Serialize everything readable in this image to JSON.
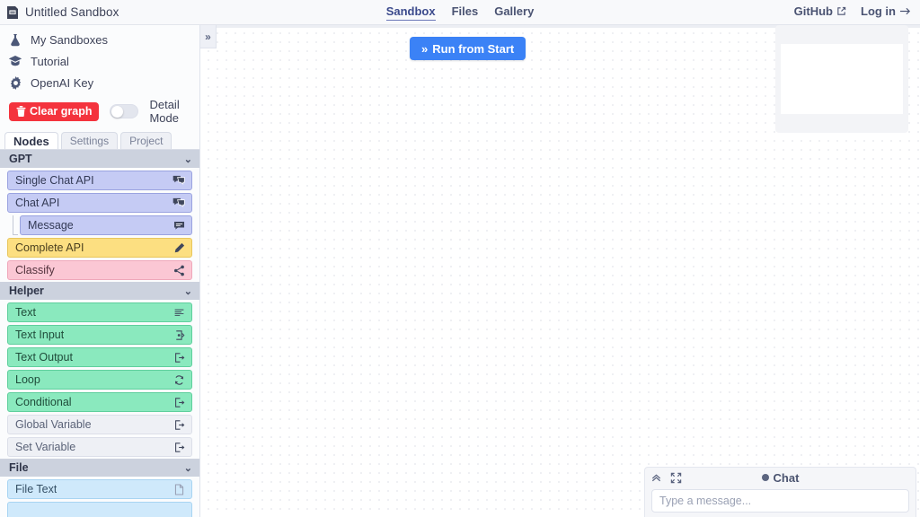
{
  "topbar": {
    "doc_icon": "file-save-icon",
    "title": "Untitled Sandbox",
    "nav": [
      {
        "label": "Sandbox",
        "active": true
      },
      {
        "label": "Files",
        "active": false
      },
      {
        "label": "Gallery",
        "active": false
      }
    ],
    "github_label": "GitHub",
    "github_icon": "external-link-icon",
    "login_label": "Log in",
    "login_icon": "arrow-right-icon"
  },
  "sidebar": {
    "menu": [
      {
        "label": "My Sandboxes",
        "icon": "flask-icon"
      },
      {
        "label": "Tutorial",
        "icon": "graduation-cap-icon"
      },
      {
        "label": "OpenAI Key",
        "icon": "gear-icon"
      }
    ],
    "clear_graph_label": "Clear graph",
    "clear_graph_icon": "trash-icon",
    "detail_mode_label": "Detail Mode",
    "detail_mode_on": false,
    "tabs": [
      {
        "label": "Nodes",
        "active": true
      },
      {
        "label": "Settings",
        "active": false
      },
      {
        "label": "Project",
        "active": false
      }
    ],
    "groups": [
      {
        "title": "GPT",
        "caret": "chevron-down-icon",
        "nodes": [
          {
            "label": "Single Chat API",
            "style": "n-gpt",
            "icon": "chat-bubbles-icon",
            "indent": false
          },
          {
            "label": "Chat API",
            "style": "n-gpt",
            "icon": "chat-bubbles-icon",
            "indent": false
          },
          {
            "label": "Message",
            "style": "n-gpt",
            "icon": "message-icon",
            "indent": true
          },
          {
            "label": "Complete API",
            "style": "n-yellow",
            "icon": "pencil-icon",
            "indent": false
          },
          {
            "label": "Classify",
            "style": "n-pink",
            "icon": "share-nodes-icon",
            "indent": false
          }
        ]
      },
      {
        "title": "Helper",
        "caret": "chevron-down-icon",
        "nodes": [
          {
            "label": "Text",
            "style": "n-green",
            "icon": "text-lines-icon",
            "indent": false
          },
          {
            "label": "Text Input",
            "style": "n-green",
            "icon": "input-icon",
            "indent": false
          },
          {
            "label": "Text Output",
            "style": "n-green",
            "icon": "output-icon",
            "indent": false
          },
          {
            "label": "Loop",
            "style": "n-green",
            "icon": "loop-icon",
            "indent": false
          },
          {
            "label": "Conditional",
            "style": "n-green",
            "icon": "output-icon",
            "indent": false
          },
          {
            "label": "Global Variable",
            "style": "n-grey",
            "icon": "output-icon",
            "indent": false
          },
          {
            "label": "Set Variable",
            "style": "n-grey",
            "icon": "output-icon",
            "indent": false
          }
        ]
      },
      {
        "title": "File",
        "caret": "chevron-down-icon",
        "nodes": [
          {
            "label": "File Text",
            "style": "n-blue",
            "icon": "document-icon",
            "indent": false
          },
          {
            "label": "",
            "style": "n-blue",
            "icon": "",
            "indent": false
          }
        ]
      }
    ]
  },
  "canvas": {
    "collapse_toggle_icon": "chevron-double-right-icon",
    "run_button_label": "Run from Start",
    "run_button_icon": "double-chevron-right-icon",
    "minimap_name": "graph-minimap"
  },
  "chat": {
    "title": "Chat",
    "status_dot_color": "#5c6580",
    "collapse_icon": "chevron-double-up-icon",
    "expand_icon": "fullscreen-icon",
    "input_placeholder": "Type a message..."
  },
  "colors": {
    "accent_blue": "#3b82f6",
    "danger_red": "#f4333d",
    "gpt_node": "#c5cbf4",
    "helper_node": "#8ae9be",
    "file_node": "#cfe9fb",
    "group_header": "#ccd2de"
  }
}
